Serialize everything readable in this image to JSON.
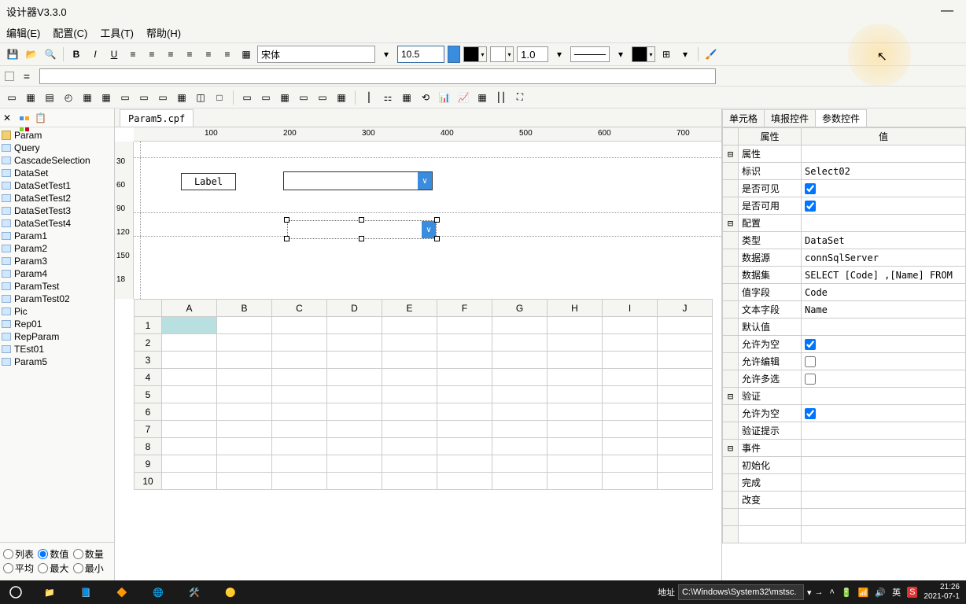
{
  "title": "设计器V3.3.0",
  "menu": {
    "edit": "编辑(E)",
    "config": "配置(C)",
    "tool": "工具(T)",
    "help": "帮助(H)"
  },
  "toolbar": {
    "font": "宋体",
    "fontsize": "10.5",
    "linewidth": "1.0"
  },
  "left": {
    "folder": "Param",
    "items": [
      "Query",
      "CascadeSelection",
      "DataSet",
      "DataSetTest1",
      "DataSetTest2",
      "DataSetTest3",
      "DataSetTest4",
      "Param1",
      "Param2",
      "Param3",
      "Param4",
      "ParamTest",
      "ParamTest02",
      "Pic",
      "Rep01",
      "RepParam",
      "TEst01",
      "Param5"
    ],
    "radios": {
      "r1": "列表",
      "r2": "数值",
      "r3": "数量",
      "r4": "平均",
      "r5": "最大",
      "r6": "最小"
    }
  },
  "tab": "Param5.cpf",
  "designer": {
    "label": "Label"
  },
  "ruler_h": [
    "100",
    "200",
    "300",
    "400",
    "500",
    "600",
    "700"
  ],
  "ruler_v": [
    "30",
    "60",
    "90",
    "120",
    "150",
    "18"
  ],
  "grid": {
    "cols": [
      "A",
      "B",
      "C",
      "D",
      "E",
      "F",
      "G",
      "H",
      "I",
      "J"
    ],
    "rows": [
      "1",
      "2",
      "3",
      "4",
      "5",
      "6",
      "7",
      "8",
      "9",
      "10"
    ]
  },
  "rp_tabs": {
    "t1": "单元格",
    "t2": "填报控件",
    "t3": "参数控件"
  },
  "prop_header": {
    "k": "属性",
    "v": "值"
  },
  "props": [
    {
      "type": "group",
      "label": "属性"
    },
    {
      "type": "kv",
      "k": "标识",
      "v": "Select02"
    },
    {
      "type": "chk",
      "k": "是否可见",
      "v": true
    },
    {
      "type": "chk",
      "k": "是否可用",
      "v": true
    },
    {
      "type": "group",
      "label": "配置"
    },
    {
      "type": "kv",
      "k": "类型",
      "v": "DataSet"
    },
    {
      "type": "kv",
      "k": "数据源",
      "v": "connSqlServer"
    },
    {
      "type": "kv",
      "k": "数据集",
      "v": "SELECT [Code]     ,[Name]  FROM"
    },
    {
      "type": "kv",
      "k": "值字段",
      "v": "Code"
    },
    {
      "type": "kv",
      "k": "文本字段",
      "v": "Name"
    },
    {
      "type": "kv",
      "k": "默认值",
      "v": ""
    },
    {
      "type": "chk",
      "k": "允许为空",
      "v": true
    },
    {
      "type": "chk",
      "k": "允许编辑",
      "v": false
    },
    {
      "type": "chk",
      "k": "允许多选",
      "v": false
    },
    {
      "type": "group",
      "label": "验证"
    },
    {
      "type": "chk",
      "k": "允许为空",
      "v": true
    },
    {
      "type": "kv",
      "k": "验证提示",
      "v": ""
    },
    {
      "type": "group",
      "label": "事件"
    },
    {
      "type": "kv",
      "k": "初始化",
      "v": ""
    },
    {
      "type": "kv",
      "k": "完成",
      "v": ""
    },
    {
      "type": "kv",
      "k": "改变",
      "v": ""
    }
  ],
  "taskbar": {
    "addr_label": "地址",
    "addr": "C:\\Windows\\System32\\mstsc.",
    "time": "21:26",
    "date": "2021-07-1",
    "ime": "英"
  }
}
